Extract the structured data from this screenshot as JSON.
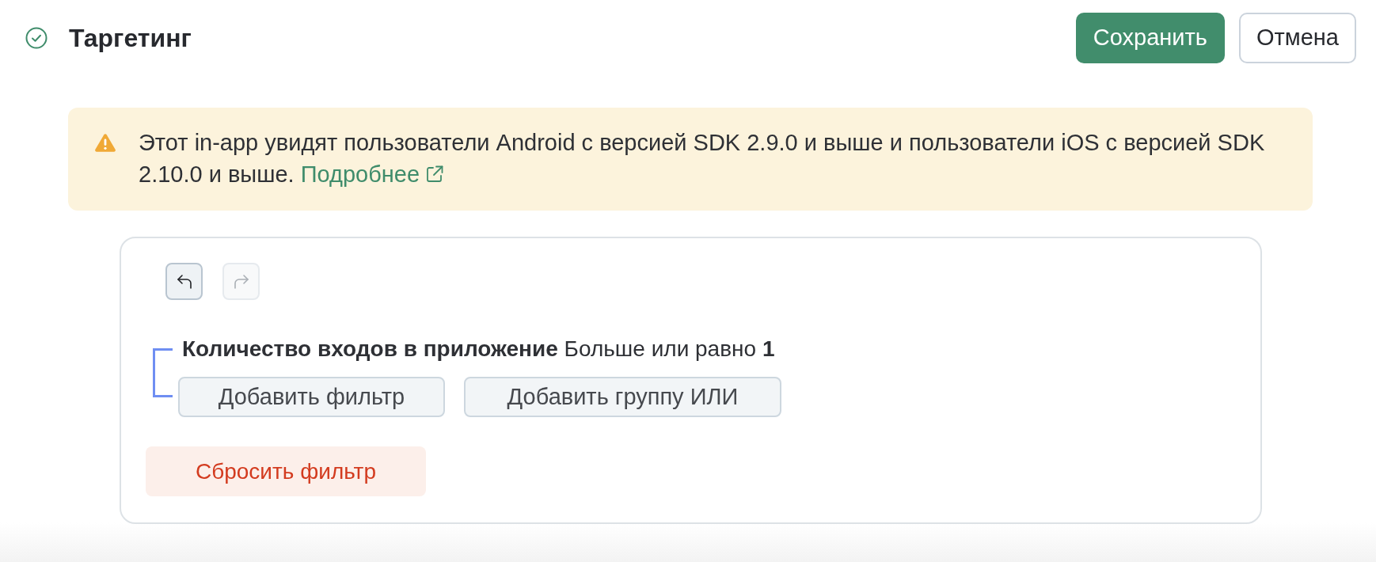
{
  "header": {
    "title": "Таргетинг",
    "buttons": [
      {
        "label": "Сохранить",
        "kind": "primary"
      },
      {
        "label": "Отмена",
        "kind": "secondary"
      }
    ]
  },
  "alert": {
    "text": "Этот in-app увидят пользователи Android с версией SDK 2.9.0 и выше и пользователи iOS с версией SDK 2.10.0 и выше.",
    "link": "Подробнее"
  },
  "editor": {
    "history": [
      {
        "kind": "undo",
        "disabled": false
      },
      {
        "kind": "redo",
        "disabled": true
      }
    ],
    "group": {
      "condition": "**Количество входов в приложение** Больше или равно **1**",
      "actions": [
        "Добавить фильтр",
        "Добавить группу ИЛИ"
      ]
    },
    "reset": "Сбросить фильтр"
  }
}
